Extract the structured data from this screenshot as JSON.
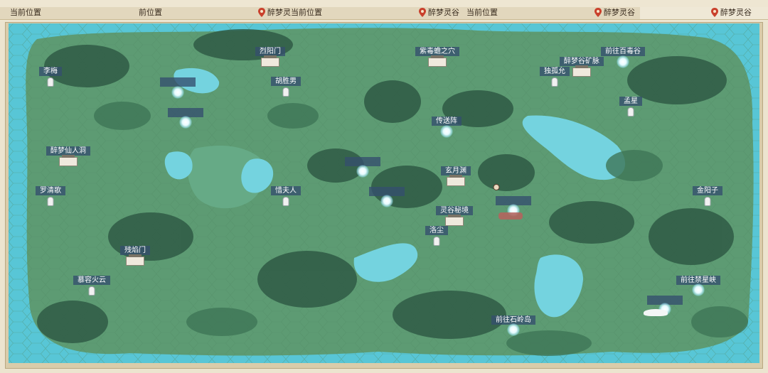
{
  "header": {
    "segments": [
      {
        "current_label": "当前位置",
        "region_label": "前位置",
        "region_name": "醉梦灵"
      },
      {
        "current_label": "当前位置",
        "region_name": "醉梦灵谷"
      },
      {
        "current_label": "当前位置",
        "region_name": "醉梦灵谷"
      },
      {
        "region_name": "醉梦灵谷"
      }
    ]
  },
  "map": {
    "region": "醉梦灵谷",
    "markers": [
      {
        "label": "李梅",
        "kind": "npc"
      },
      {
        "label": "烈阳门",
        "kind": "sect"
      },
      {
        "label": "",
        "kind": "portal"
      },
      {
        "label": "胡胜男",
        "kind": "npc"
      },
      {
        "label": "",
        "kind": "portal"
      },
      {
        "label": "紫毒蟾之穴",
        "kind": "landmark"
      },
      {
        "label": "醉梦谷矿脉",
        "kind": "landmark"
      },
      {
        "label": "前往百毒谷",
        "kind": "exit-portal"
      },
      {
        "label": "独孤允",
        "kind": "npc"
      },
      {
        "label": "孟星",
        "kind": "npc"
      },
      {
        "label": "传送阵",
        "kind": "teleport"
      },
      {
        "label": "醉梦仙人洞",
        "kind": "landmark"
      },
      {
        "label": "",
        "kind": "portal"
      },
      {
        "label": "玄月渊",
        "kind": "landmark"
      },
      {
        "label": "罗清歌",
        "kind": "npc"
      },
      {
        "label": "惜夫人",
        "kind": "npc"
      },
      {
        "label": "",
        "kind": "portal"
      },
      {
        "label": "",
        "kind": "portal"
      },
      {
        "label": "金阳子",
        "kind": "npc"
      },
      {
        "label": "灵谷秘境",
        "kind": "landmark"
      },
      {
        "label": "洛尘",
        "kind": "npc"
      },
      {
        "label": "残焰门",
        "kind": "sect"
      },
      {
        "label": "慕容火云",
        "kind": "npc"
      },
      {
        "label": "前往禁星峡",
        "kind": "exit-portal"
      },
      {
        "label": "",
        "kind": "portal"
      },
      {
        "label": "前往石岭岛",
        "kind": "exit-portal"
      }
    ]
  },
  "colors": {
    "grass": "#5d9b73",
    "water": "#58c6d6",
    "label_bg": "#344e6e",
    "header_bg": "#e2d7bd"
  }
}
